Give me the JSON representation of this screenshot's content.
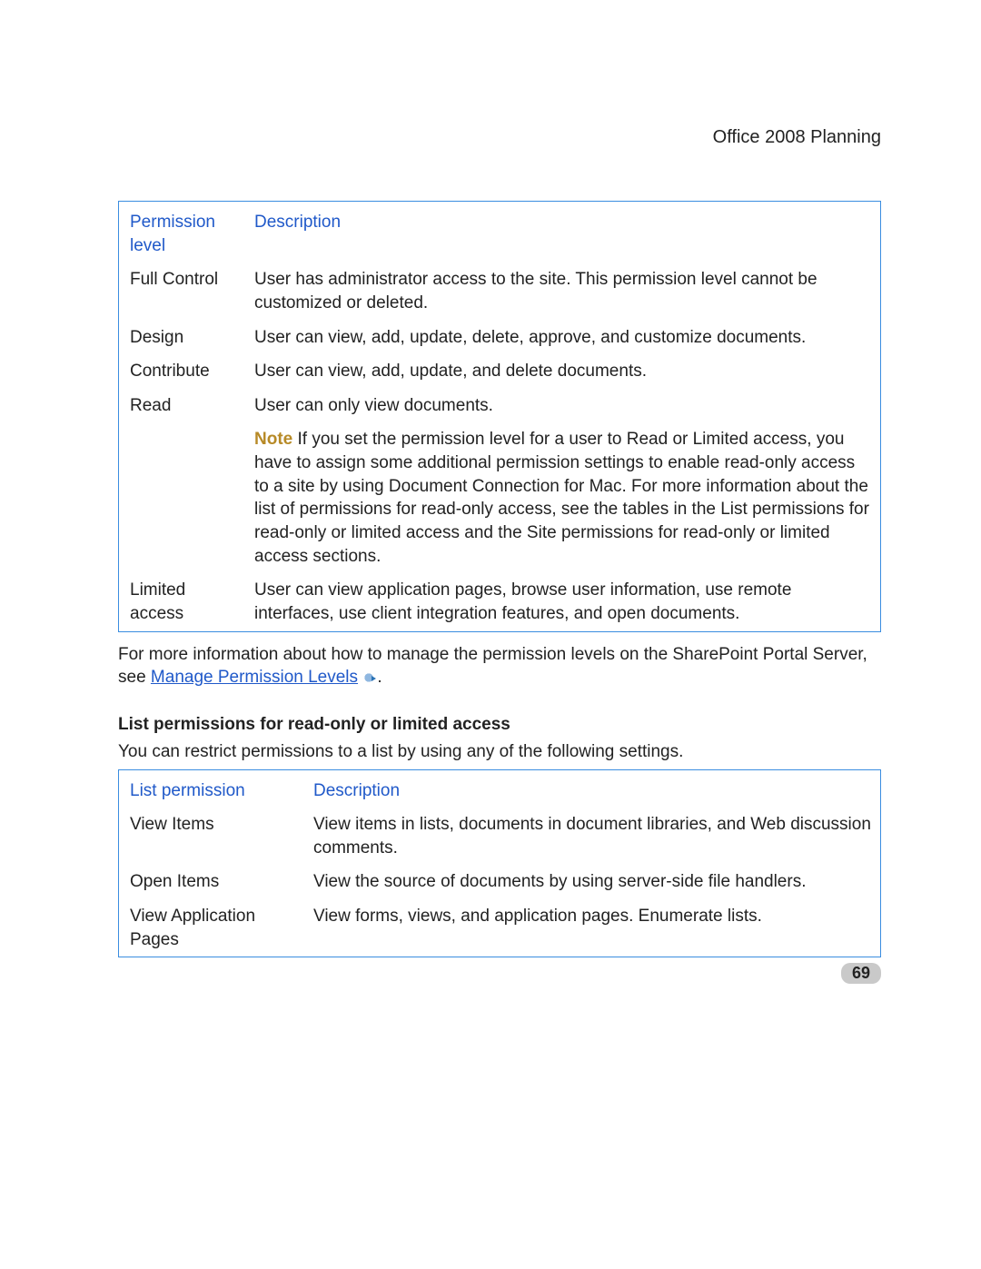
{
  "header": {
    "title": "Office 2008 Planning"
  },
  "table1": {
    "col1": "Permission level",
    "col2": "Description",
    "rows": [
      {
        "level": "Full Control",
        "desc": "User has administrator access to the site. This permission level cannot be customized or deleted."
      },
      {
        "level": "Design",
        "desc": "User can view, add, update, delete, approve, and customize documents."
      },
      {
        "level": "Contribute",
        "desc": "User can view, add, update, and delete documents."
      },
      {
        "level": "Read",
        "desc": "User can only view documents."
      },
      {
        "level": "",
        "note_label": "Note",
        "desc": " If you set the permission level for a user to Read or Limited access, you have to assign some additional permission settings to enable read-only access to a site by using Document Connection for Mac. For more information about the list of permissions for read-only access, see the tables in the List permissions for read-only or limited access and the Site permissions for read-only or limited access sections."
      },
      {
        "level": "Limited access",
        "desc": "User can view application pages, browse user information, use remote interfaces, use client integration features, and open documents."
      }
    ]
  },
  "para_after_table1_pre": "For more information about how to manage the permission levels on the SharePoint Portal Server, see ",
  "link_text": "Manage Permission Levels",
  "para_after_table1_post": ".",
  "section_head": "List permissions for read-only or limited access",
  "para_before_table2": "You can restrict permissions to a list by using any of the following settings.",
  "table2": {
    "col1": "List permission",
    "col2": "Description",
    "rows": [
      {
        "perm": "View Items",
        "desc": "View items in lists, documents in document libraries, and Web discussion comments."
      },
      {
        "perm": "Open Items",
        "desc": "View the source of documents by using server-side file handlers."
      },
      {
        "perm": "View Application Pages",
        "desc": "View forms, views, and application pages. Enumerate lists."
      }
    ]
  },
  "page_number": "69"
}
